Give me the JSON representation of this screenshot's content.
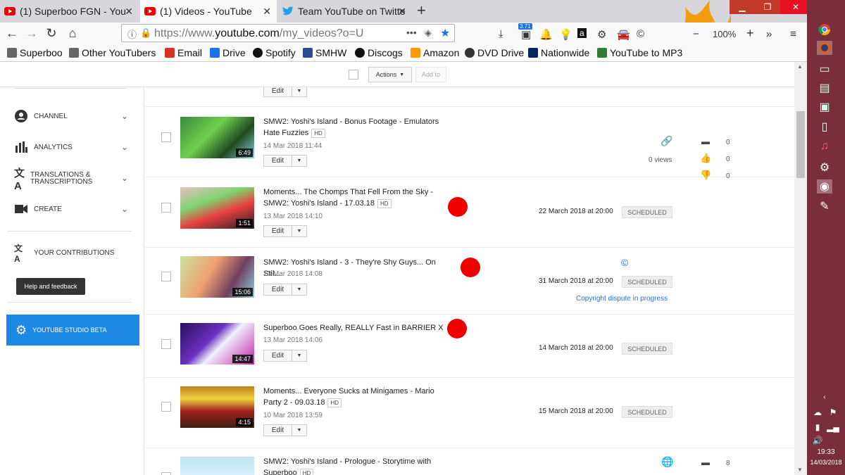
{
  "tabs": [
    {
      "title": "(1) Superboo FGN - You",
      "active": false
    },
    {
      "title": "(1) Videos - YouTube",
      "active": true
    },
    {
      "title": "Team YouTube on Twitte",
      "active": false
    }
  ],
  "new_tab": "+",
  "address": {
    "prefix": "https://www.",
    "domain": "youtube.com",
    "path": "/my_videos?o=U"
  },
  "zoom": "100%",
  "badge_count": "3.71",
  "bookmarks": [
    {
      "label": "Superboo",
      "color": "#444"
    },
    {
      "label": "Other YouTubers",
      "color": "#444"
    },
    {
      "label": "Email",
      "color": "#d93025"
    },
    {
      "label": "Drive",
      "color": "#1a73e8"
    },
    {
      "label": "Spotify",
      "color": "#111"
    },
    {
      "label": "SMHW",
      "color": "#2a4b8d"
    },
    {
      "label": "Discogs",
      "color": "#111"
    },
    {
      "label": "Amazon",
      "color": "#f90"
    },
    {
      "label": "DVD Drive",
      "color": "#333"
    },
    {
      "label": "Nationwide",
      "color": "#002664"
    },
    {
      "label": "YouTube to MP3",
      "color": "#2e7d32"
    }
  ],
  "toolbar": {
    "actions_label": "Actions",
    "add_to_label": "Add to"
  },
  "sidebar": {
    "items": [
      {
        "label": "Channel"
      },
      {
        "label": "Analytics"
      },
      {
        "label": "Translations & transcriptions"
      },
      {
        "label": "Create"
      }
    ],
    "contributions": "Your contributions",
    "help": "Help and feedback",
    "studio": "YouTube Studio Beta"
  },
  "edit_label": "Edit",
  "hd_label": "HD",
  "videos": [
    {
      "title": "SMW2: Yoshi's Island - Bonus Footage - Emulators Hate Fuzzies",
      "hd": true,
      "date": "14 Mar 2018 11:44",
      "duration": "6:49",
      "views": "0 views",
      "comments": "0",
      "likes": "0",
      "dislikes": "0"
    },
    {
      "title": "Moments... The Chomps That Fell From the Sky - SMW2: Yoshi's Island - 17.03.18",
      "hd": true,
      "date": "13 Mar 2018 14:10",
      "duration": "1:51",
      "scheduled": "22 March 2018 at 20:00",
      "status": "SCHEDULED"
    },
    {
      "title": "SMW2: Yoshi's Island - 3 - They're Shy Guys... On Stil...",
      "hd": false,
      "date": "13 Mar 2018 14:08",
      "duration": "15:06",
      "scheduled": "31 March 2018 at 20:00",
      "status": "SCHEDULED",
      "note": "Copyright dispute in progress"
    },
    {
      "title": "Superboo Goes Really, REALLY Fast in BARRIER X",
      "hd": false,
      "date": "13 Mar 2018 14:06",
      "duration": "14:47",
      "scheduled": "14 March 2018 at 20:00",
      "status": "SCHEDULED"
    },
    {
      "title": "Moments... Everyone Sucks at Minigames - Mario Party 2 - 09.03.18",
      "hd": true,
      "date": "10 Mar 2018 13:59",
      "duration": "4:15",
      "scheduled": "15 March 2018 at 20:00",
      "status": "SCHEDULED"
    },
    {
      "title": "SMW2: Yoshi's Island - Prologue - Storytime with Superboo",
      "hd": true,
      "comments": "8"
    }
  ],
  "clock": {
    "time": "19:33",
    "date": "14/03/2018"
  },
  "colors": {
    "accent": "#1a73e8",
    "sidebar_active": "#1e88e5",
    "red_dot": "#e00000",
    "taskbar": "#7a2e3c"
  }
}
